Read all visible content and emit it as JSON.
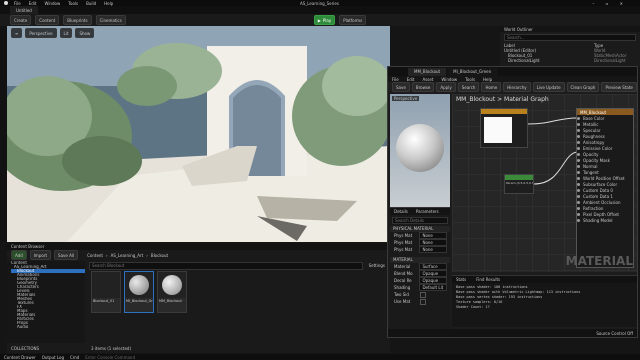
{
  "title_bar": {
    "menu": [
      "File",
      "Edit",
      "Window",
      "Tools",
      "Build",
      "Help"
    ],
    "level_tab": "Untitled",
    "project_name": "AS_Learning_Series"
  },
  "main_toolbar": {
    "create": "Create",
    "content": "Content",
    "blueprints": "Blueprints",
    "cinematics": "Cinematics",
    "play": "Play",
    "platforms": "Platforms"
  },
  "viewport": {
    "perspective": "Perspective",
    "lit": "Lit",
    "show": "Show"
  },
  "outliner": {
    "title": "World Outliner",
    "search_placeholder": "Search...",
    "col_label": "Label",
    "col_type": "Type",
    "items": [
      {
        "label": "Untitled (Editor)",
        "type": "World"
      },
      {
        "label": "Blockout_01",
        "type": "StaticMeshActor"
      },
      {
        "label": "DirectionalLight",
        "type": "DirectionalLight"
      }
    ]
  },
  "content_browser": {
    "title": "Content Browser",
    "add": "Add",
    "import": "Import",
    "save_all": "Save All",
    "breadcrumb": [
      "Content",
      "AS_Learning_Art",
      "Blockout"
    ],
    "search_placeholder": "Search Blockout",
    "settings": "Settings",
    "tree": [
      "Content",
      "AS_Learning_Art",
      "Blockout",
      "Animations",
      "Blueprints",
      "Geometry",
      "Characters",
      "Levels",
      "Materials",
      "Meshes",
      "Textures",
      "FX",
      "Maps",
      "Materials",
      "Particles",
      "Props",
      "Audio"
    ],
    "assets": [
      "Blockout_01",
      "MI_Blockout_Green",
      "MM_Blockout"
    ],
    "status": "3 items (1 selected)",
    "collections": "COLLECTIONS"
  },
  "bottom_bar": {
    "drawer": "Content Drawer",
    "output_log": "Output Log",
    "cmd": "Cmd",
    "console_placeholder": "Enter Console Command"
  },
  "material_editor": {
    "tab": "MM_Blockout",
    "tab2": "MI_Blockout_Green",
    "menu": [
      "File",
      "Edit",
      "Asset",
      "Window",
      "Tools",
      "Help"
    ],
    "toolbar": [
      "Save",
      "Browse",
      "Apply",
      "Search",
      "Home",
      "Hierarchy",
      "Live Update",
      "Clean Graph",
      "Preview State"
    ],
    "viewport_label": "Perspective",
    "graph_label": "Material Graph",
    "breadcrumb": "MM_Blockout > Material Graph",
    "details": "Details",
    "parameters": "Parameters",
    "search_placeholder": "Search Details",
    "physical_section": "PHYSICAL MATERIAL",
    "material_section": "MATERIAL",
    "props": [
      {
        "label": "Phys Mat",
        "value": "None"
      },
      {
        "label": "Phys Mat",
        "value": "None"
      },
      {
        "label": "Phys Mat",
        "value": "None"
      }
    ],
    "mat_props": [
      {
        "label": "Material",
        "value": "Surface"
      },
      {
        "label": "Blend Mo",
        "value": "Opaque"
      },
      {
        "label": "Decal Re",
        "value": "Opaque"
      },
      {
        "label": "Shading",
        "value": "Default Lit"
      },
      {
        "label": "Two Sid",
        "value": ""
      },
      {
        "label": "Use Mat",
        "value": ""
      }
    ],
    "node_output": "MM_Blockout",
    "node_pins": [
      "Base Color",
      "Metallic",
      "Specular",
      "Roughness",
      "Anisotropy",
      "Emissive Color",
      "Opacity",
      "Opacity Mask",
      "Normal",
      "Tangent",
      "World Position Offset",
      "Subsurface Color",
      "Custom Data 0",
      "Custom Data 1",
      "Ambient Occlusion",
      "Refraction",
      "Pixel Depth Offset",
      "Shading Model"
    ],
    "param_node": "Param (0.5,0.5,0.5)",
    "watermark": "MATERIAL",
    "stats_title": "Stats",
    "find_results": "Find Results",
    "stats": [
      "Base pass shader: 100 instructions",
      "Base pass shader with Volumetric Lightmap: 113 instructions",
      "Base pass vertex shader: 193 instructions",
      "Texture samplers: 0/16",
      "Shader Count: 17"
    ],
    "source_control": "Source Control Off"
  },
  "colors": {
    "accent_blue": "#2f6fbf",
    "play_green": "#2e8b3a",
    "node_orange": "#b8811d",
    "node_green": "#3a8a3a",
    "panel": "#1c1c1c",
    "sky": "#8fa4b5"
  }
}
